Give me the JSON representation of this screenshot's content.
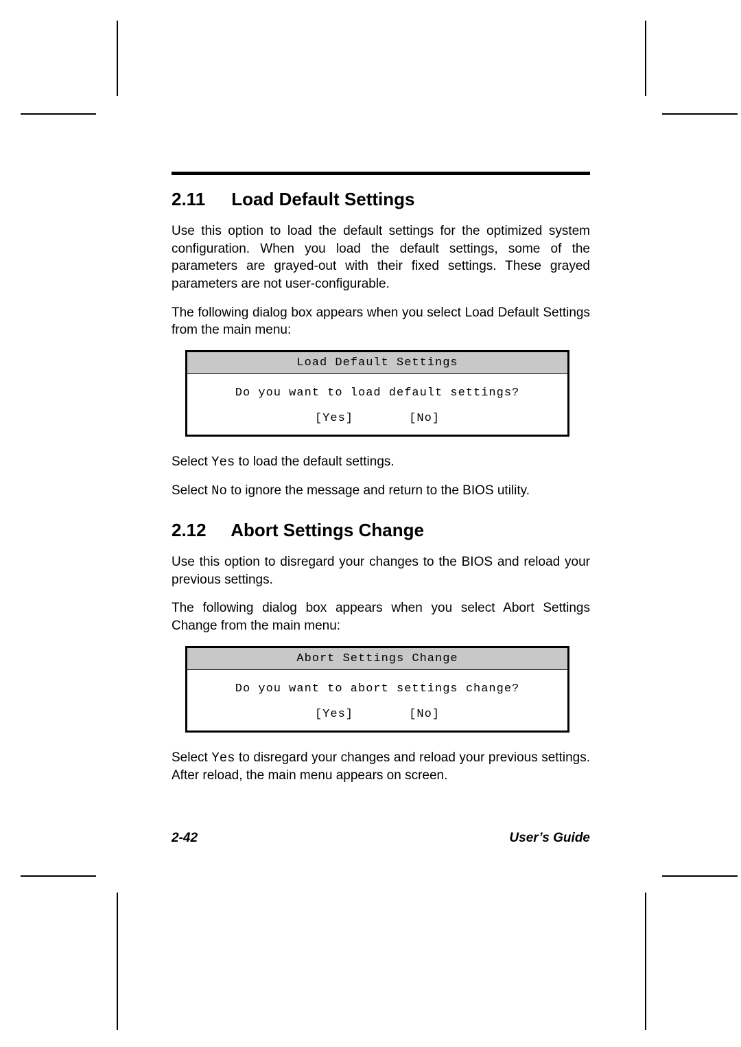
{
  "section1": {
    "num": "2.11",
    "title": "Load Default Settings",
    "para1": "Use this option to load the default settings for the optimized system configuration.  When you load the default settings, some of the parameters are grayed-out with their fixed settings.  These grayed parameters are not user-configurable.",
    "para2": "The following dialog box appears when you select Load Default Settings from the main menu:",
    "dialog": {
      "title": "Load Default Settings",
      "question": "Do you want to load default settings?",
      "yes": "[Yes]",
      "no": "[No]"
    },
    "after1_a": "Select ",
    "after1_code": "Yes",
    "after1_b": " to load the default settings.",
    "after2_a": "Select ",
    "after2_code": "No",
    "after2_b": " to ignore the message and return to the BIOS utility."
  },
  "section2": {
    "num": "2.12",
    "title": "Abort Settings Change",
    "para1": "Use this option to disregard your changes to the BIOS and reload your previous settings.",
    "para2": "The following dialog box appears when you select Abort Settings Change from the main menu:",
    "dialog": {
      "title": "Abort Settings Change",
      "question": "Do you want to abort settings change?",
      "yes": "[Yes]",
      "no": "[No]"
    },
    "after1_a": "Select ",
    "after1_code": "Yes",
    "after1_b": " to disregard your changes and reload your previous settings.  After reload, the main menu appears on screen."
  },
  "footer": {
    "page": "2-42",
    "doc": "User’s Guide"
  }
}
